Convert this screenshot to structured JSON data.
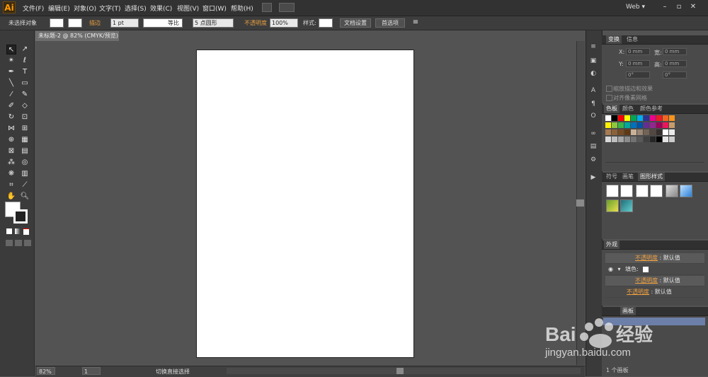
{
  "app": {
    "logo": "Ai",
    "workspace": "Web ▾"
  },
  "menu": [
    "文件(F)",
    "编辑(E)",
    "对象(O)",
    "文字(T)",
    "选择(S)",
    "效果(C)",
    "视图(V)",
    "窗口(W)",
    "帮助(H)"
  ],
  "control": {
    "selection": "未选择对象",
    "stroke_label": "描边",
    "stroke_weight": "1 pt",
    "stroke_profile": "等比",
    "brush": "5 点圆形",
    "opacity_label": "不透明度",
    "opacity_value": "100%",
    "style_label": "样式:",
    "doc_setup": "文档设置",
    "prefs": "首选项"
  },
  "document": {
    "tab": "未标题-2 @ 82% (CMYK/预览)"
  },
  "status": {
    "zoom": "82%",
    "page": "1",
    "tool_text": "切换直接选择"
  },
  "transform": {
    "tabs": [
      "变换",
      "信息"
    ],
    "x_label": "X:",
    "x_value": "0 mm",
    "y_label": "Y:",
    "y_value": "0 mm",
    "w_label": "宽:",
    "w_value": "0 mm",
    "h_label": "高:",
    "h_value": "0 mm",
    "angle1": "0°",
    "angle2": "0°",
    "opt1": "缩放描边和效果",
    "opt2": "对齐像素网格"
  },
  "swatches": {
    "tabs": [
      "色板",
      "颜色",
      "颜色参考"
    ],
    "colors": [
      [
        "#ffffff",
        "#000000",
        "#ff0000",
        "#ffff00",
        "#00a651",
        "#00aeef",
        "#2e3192",
        "#ec008c",
        "#ed1c24",
        "#f26522",
        "#f7941d"
      ],
      [
        "#fff200",
        "#8dc63f",
        "#39b54a",
        "#00a99d",
        "#0072bc",
        "#0054a6",
        "#662d91",
        "#92278f",
        "#9e005d",
        "#ed145b",
        "#c69c6d"
      ],
      [
        "#a67c52",
        "#8c6239",
        "#754c24",
        "#603913",
        "#c7b299",
        "#998675",
        "#736357",
        "#534741",
        "#362f2d",
        "#ffffff",
        "#ebebeb"
      ],
      [
        "#d9d9d9",
        "#bfbfbf",
        "#a6a6a6",
        "#8c8c8c",
        "#737373",
        "#595959",
        "#404040",
        "#262626",
        "#000000",
        "#e5e5e5",
        "#cccccc"
      ]
    ]
  },
  "graphic_styles": {
    "tabs": [
      "符号",
      "画笔",
      "图形样式"
    ]
  },
  "appearance": {
    "title": "外观",
    "rows": [
      {
        "label": "不透明度",
        "value": "默认值"
      },
      {
        "label": "填色:",
        "value": ""
      },
      {
        "label": "不透明度",
        "value": "默认值"
      },
      {
        "label": "不透明度",
        "value": "默认值"
      }
    ]
  },
  "layers": {
    "title": "画板",
    "footer": "1 个画板"
  },
  "watermark": {
    "text": "jingyan.baidu.com"
  }
}
